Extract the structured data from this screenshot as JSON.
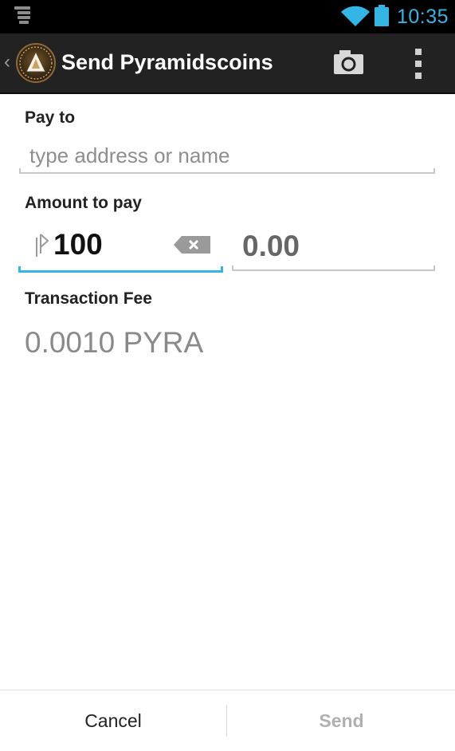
{
  "status_bar": {
    "time": "10:35",
    "icons": [
      "notification-icon",
      "wifi-icon",
      "battery-icon"
    ],
    "accent_color": "#33b5e5"
  },
  "action_bar": {
    "title": "Send Pyramidscoins",
    "icons": [
      "back-caret-icon",
      "app-logo",
      "camera-icon",
      "overflow-menu-icon"
    ],
    "background_color": "#222222"
  },
  "form": {
    "pay_to": {
      "label": "Pay to",
      "placeholder": "type address or name"
    },
    "amount": {
      "label": "Amount to pay",
      "btc_value": "100",
      "currency_icon": "coin-symbol-icon",
      "clear_icon": "backspace-clear-icon",
      "local_value": "0.00"
    },
    "fee": {
      "label": "Transaction Fee",
      "value": "0.0010 PYRA"
    }
  },
  "buttons": {
    "cancel": "Cancel",
    "send": "Send"
  }
}
